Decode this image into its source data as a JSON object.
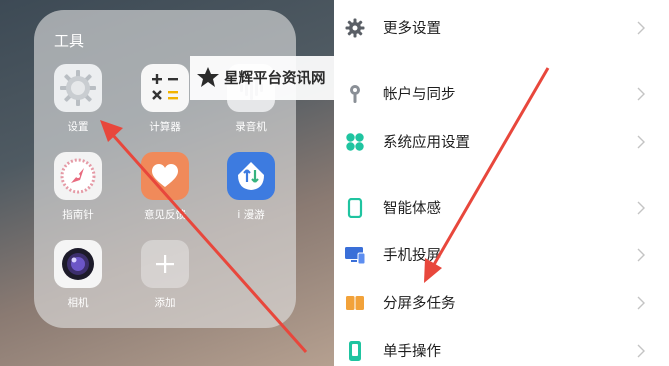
{
  "folder": {
    "title": "工具",
    "apps": [
      {
        "label": "设置",
        "icon": "settings-gear-icon"
      },
      {
        "label": "计算器",
        "icon": "calculator-icon"
      },
      {
        "label": "录音机",
        "icon": "sound-recorder-icon"
      },
      {
        "label": "指南针",
        "icon": "compass-icon"
      },
      {
        "label": "意见反馈",
        "icon": "feedback-heart-icon"
      },
      {
        "label": "i 漫游",
        "icon": "roaming-icon"
      },
      {
        "label": "相机",
        "icon": "camera-icon"
      },
      {
        "label": "添加",
        "icon": "add-plus-icon"
      }
    ]
  },
  "settings": {
    "items": [
      {
        "label": "更多设置",
        "icon": "gear-icon"
      },
      {
        "label": "帐户与同步",
        "icon": "account-sync-icon"
      },
      {
        "label": "系统应用设置",
        "icon": "app-grid-icon"
      },
      {
        "label": "智能体感",
        "icon": "smart-motion-icon"
      },
      {
        "label": "手机投屏",
        "icon": "screen-cast-icon"
      },
      {
        "label": "分屏多任务",
        "icon": "split-screen-icon"
      },
      {
        "label": "单手操作",
        "icon": "one-hand-icon"
      }
    ]
  },
  "watermark": {
    "text": "星辉平台资讯网"
  },
  "colors": {
    "arrow": "#e8473c",
    "accent_green": "#1fc4a0",
    "cast_blue": "#3a6fd8",
    "split_orange": "#f2a23a"
  }
}
